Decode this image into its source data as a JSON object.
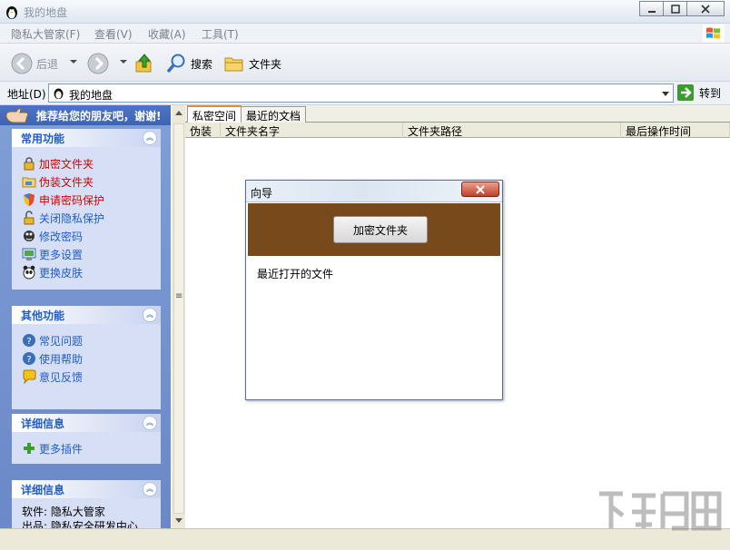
{
  "window": {
    "title": "我的地盘"
  },
  "menu": {
    "items": [
      "隐私大管家(F)",
      "查看(V)",
      "收藏(A)",
      "工具(T)"
    ]
  },
  "toolbar": {
    "back": "后退",
    "search": "搜索",
    "folders": "文件夹"
  },
  "address": {
    "label": "地址(D)",
    "value": "我的地盘",
    "go": "转到"
  },
  "sidebar": {
    "banner": "推荐给您的朋友吧，谢谢!",
    "panels": [
      {
        "title": "常用功能",
        "items": [
          {
            "label": "加密文件夹",
            "icon": "lock-icon"
          },
          {
            "label": "伪装文件夹",
            "icon": "disguise-icon"
          },
          {
            "label": "申请密码保护",
            "icon": "shield-icon"
          },
          {
            "label": "关闭隐私保护",
            "icon": "unlock-icon"
          },
          {
            "label": "修改密码",
            "icon": "key-icon"
          },
          {
            "label": "更多设置",
            "icon": "settings-icon"
          },
          {
            "label": "更换皮肤",
            "icon": "skin-icon"
          }
        ]
      },
      {
        "title": "其他功能",
        "items": [
          {
            "label": "常见问题",
            "icon": "question-icon"
          },
          {
            "label": "使用帮助",
            "icon": "help-icon"
          },
          {
            "label": "意见反馈",
            "icon": "feedback-icon"
          }
        ]
      },
      {
        "title": "详细信息",
        "items": [
          {
            "label": "更多插件",
            "icon": "plus-icon"
          }
        ]
      },
      {
        "title": "详细信息",
        "items": [
          {
            "label": "软件: 隐私大管家"
          },
          {
            "label": "出品: 隐私安全研发中心"
          }
        ]
      }
    ]
  },
  "tabs": [
    "私密空间",
    "最近的文档"
  ],
  "columns": [
    "伪装",
    "文件夹名字",
    "文件夹路径",
    "最后操作时间"
  ],
  "dialog": {
    "title": "向导",
    "button": "加密文件夹",
    "recent_label": "最近打开的文件"
  },
  "colors": {
    "sidebar_blue": "#6b88c7",
    "link_blue": "#215dc6",
    "alert_red": "#d40000",
    "dialog_band": "#78491a"
  }
}
